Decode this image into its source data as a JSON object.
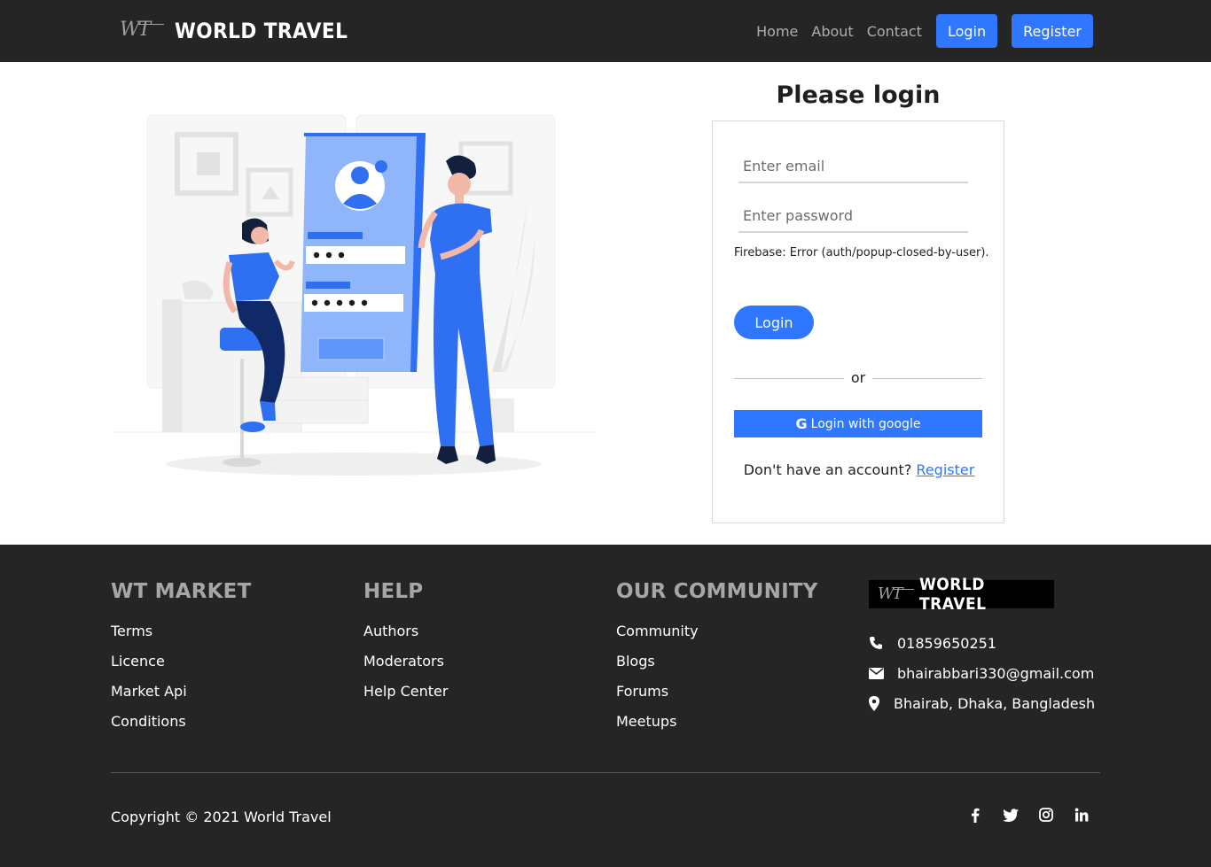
{
  "navbar": {
    "logo_mark": "WT",
    "brand": "WORLD TRAVEL",
    "links": [
      "Home",
      "About",
      "Contact"
    ],
    "login_label": "Login",
    "register_label": "Register"
  },
  "login": {
    "title": "Please login",
    "email_placeholder": "Enter email",
    "password_placeholder": "Enter password",
    "error_message": "Firebase: Error (auth/popup-closed-by-user).",
    "submit_label": "Login",
    "divider_text": "or",
    "google_label": "Login with google",
    "google_icon": "G",
    "signup_prompt": "Don't have an account?",
    "signup_link": "Register"
  },
  "footer": {
    "col1": {
      "title": "WT MARKET",
      "items": [
        "Terms",
        "Licence",
        "Market Api",
        "Conditions"
      ]
    },
    "col2": {
      "title": "HELP",
      "items": [
        "Authors",
        "Moderators",
        "Help Center"
      ]
    },
    "col3": {
      "title": "OUR COMMUNITY",
      "items": [
        "Community",
        "Blogs",
        "Forums",
        "Meetups"
      ]
    },
    "logo_mark": "WT",
    "logo_brand": "WORLD TRAVEL",
    "contact": {
      "phone": "01859650251",
      "email": "bhairabbari330@gmail.com",
      "address": "Bhairab, Dhaka, Bangladesh"
    },
    "copyright": "Copyright © 2021 World Travel",
    "socials": [
      "facebook-icon",
      "twitter-icon",
      "instagram-icon",
      "linkedin-icon"
    ]
  },
  "colors": {
    "accent": "#2f77ff",
    "dark": "#252525",
    "illustration_blue": "#2f6ff1",
    "illustration_navy": "#0f2a67"
  }
}
